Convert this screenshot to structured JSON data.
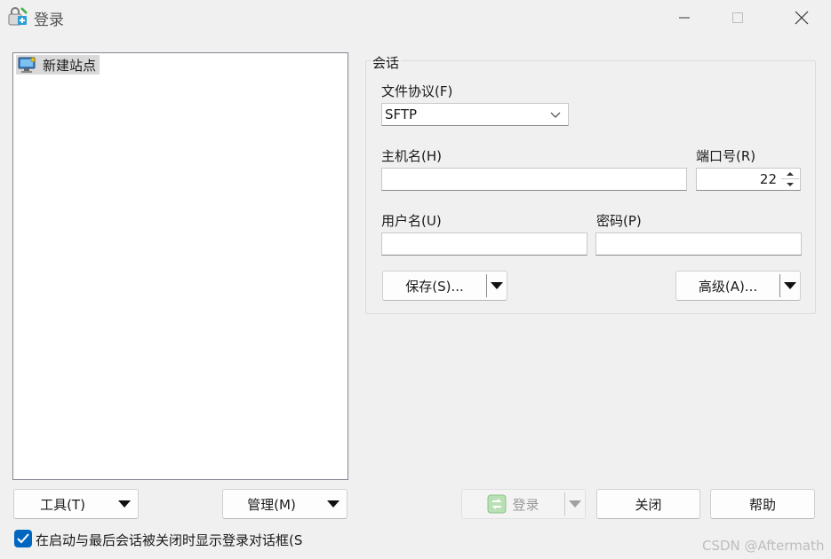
{
  "window": {
    "title": "登录",
    "controls": {
      "minimize": "minimize",
      "maximize": "maximize",
      "close": "close"
    }
  },
  "site_tree": {
    "items": [
      {
        "label": "新建站点",
        "icon": "new-site-monitor-icon",
        "selected": true
      }
    ]
  },
  "session": {
    "group_label": "会话",
    "protocol": {
      "label": "文件协议(F)",
      "value": "SFTP"
    },
    "host": {
      "label": "主机名(H)",
      "value": ""
    },
    "port": {
      "label": "端口号(R)",
      "value": "22"
    },
    "user": {
      "label": "用户名(U)",
      "value": ""
    },
    "password": {
      "label": "密码(P)",
      "value": ""
    },
    "save_button": "保存(S)...",
    "advanced_button": "高级(A)..."
  },
  "bottom_left": {
    "tools_button": "工具(T)",
    "manage_button": "管理(M)"
  },
  "bottom_right": {
    "login_button": "登录",
    "close_button": "关闭",
    "help_button": "帮助"
  },
  "options": {
    "show_login_dialog": {
      "label": "在启动与最后会话被关闭时显示登录对话框(S",
      "checked": true
    }
  },
  "watermark": "CSDN @Aftermath",
  "colors": {
    "accent": "#0067c0",
    "tree_selection": "#d9d9d9",
    "window_bg": "#f0f0f0"
  }
}
